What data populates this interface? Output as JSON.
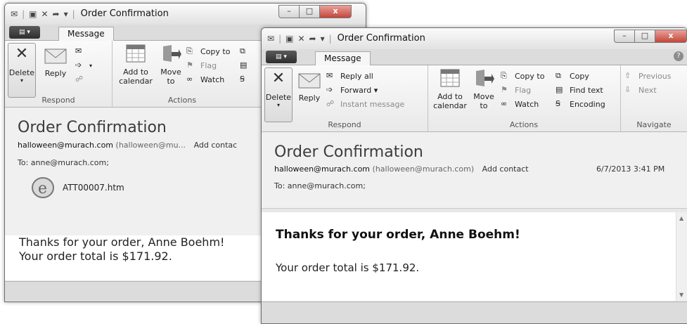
{
  "window_title": "Order Confirmation",
  "window_controls": {
    "minimize": "–",
    "maximize": "□",
    "close": "x"
  },
  "ribbon": {
    "file_tab": "▤ ▾",
    "message_tab": "Message",
    "help": "?",
    "delete": "Delete",
    "reply": "Reply",
    "reply_all": "Reply all",
    "forward": "Forward ▾",
    "instant_message": "Instant message",
    "add_to_calendar": "Add to\ncalendar",
    "move_to": "Move\nto",
    "copy_to": "Copy to",
    "flag": "Flag",
    "watch": "Watch",
    "copy": "Copy",
    "find_text": "Find text",
    "encoding": "Encoding",
    "previous": "Previous",
    "next": "Next",
    "groups": {
      "respond": "Respond",
      "actions": "Actions",
      "navigate": "Navigate"
    }
  },
  "message": {
    "subject": "Order Confirmation",
    "from_address": "halloween@murach.com",
    "from_display_full": "(halloween@murach.com)",
    "from_display_short": "(halloween@mu...",
    "add_contact": "Add contact",
    "add_contact_short": "Add contac",
    "date": "6/7/2013 3:41 PM",
    "to": "To: anne@murach.com;",
    "attachment": "ATT00007.htm",
    "greeting": "Thanks for your order, Anne Boehm!",
    "total": "Your order total is $171.92."
  },
  "icons": {
    "delete": "x-mark-icon",
    "reply": "envelope-arrow-icon",
    "calendar": "calendar-icon",
    "move": "folder-arrow-icon",
    "attachment": "internet-explorer-icon"
  },
  "colors": {
    "ribbon_bg": "#f5f5f5",
    "header_bg": "#f0f0f0",
    "close_button": "#c4463a"
  }
}
